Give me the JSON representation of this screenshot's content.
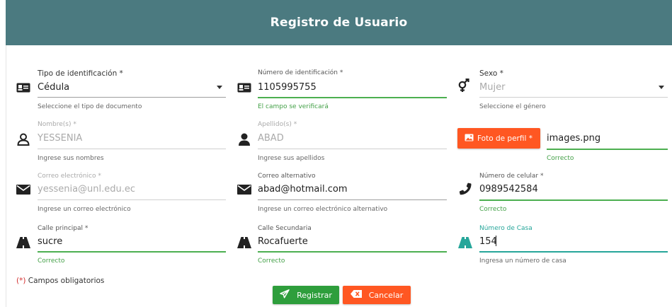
{
  "header": {
    "title": "Registro de Usuario"
  },
  "row1": {
    "tipo": {
      "label": "Tipo de identificación *",
      "value": "Cédula",
      "help": "Seleccione el tipo de documento",
      "icon": "id-card-icon"
    },
    "numero": {
      "label": "Número de identificación *",
      "value": "1105995755",
      "help": "El campo se verificará",
      "icon": "id-card-icon"
    },
    "sexo": {
      "label": "Sexo *",
      "value": "Mujer",
      "help": "Seleccione el género",
      "icon": "gender-icon"
    }
  },
  "row2": {
    "nombres": {
      "label": "Nombre(s) *",
      "value": "YESSENIA",
      "help": "Ingrese sus nombres",
      "icon": "user-outline-icon"
    },
    "apellidos": {
      "label": "Apellido(s) *",
      "value": "ABAD",
      "help": "Ingrese sus apellidos",
      "icon": "user-filled-icon"
    },
    "foto": {
      "button_label": "Foto de perfil *",
      "filename": "images.png",
      "help": "Correcto",
      "icon": "image-icon"
    }
  },
  "row3": {
    "correo": {
      "label": "Correo electrónico *",
      "value": "yessenia@unl.edu.ec",
      "help": "Ingrese un correo electrónico",
      "icon": "mail-icon"
    },
    "correo_alt": {
      "label": "Correo alternativo",
      "value": "abad@hotmail.com",
      "help": "Ingrese un correo electrónico alternativo",
      "icon": "mail-icon"
    },
    "celular": {
      "label": "Número de celular *",
      "value": "0989542584",
      "help": "Correcto",
      "icon": "phone-icon"
    }
  },
  "row4": {
    "calle_principal": {
      "label": "Calle principal *",
      "value": "sucre",
      "help": "Correcto",
      "icon": "road-icon"
    },
    "calle_secundaria": {
      "label": "Calle Secundaria",
      "value": "Rocafuerte",
      "help": "Correcto",
      "icon": "road-icon"
    },
    "numero_casa": {
      "label": "Número de Casa",
      "value": "154",
      "help": "Ingresa un número de casa",
      "icon": "road-icon"
    }
  },
  "footer": {
    "required_mark": "(*)",
    "required_text": " Campos obligatorios",
    "register_label": "Registrar",
    "cancel_label": "Cancelar"
  },
  "colors": {
    "header": "#4b7a80",
    "success": "#4caf50",
    "accent": "#26a69a",
    "orange": "#ff5722",
    "register": "#2e9e3c"
  }
}
